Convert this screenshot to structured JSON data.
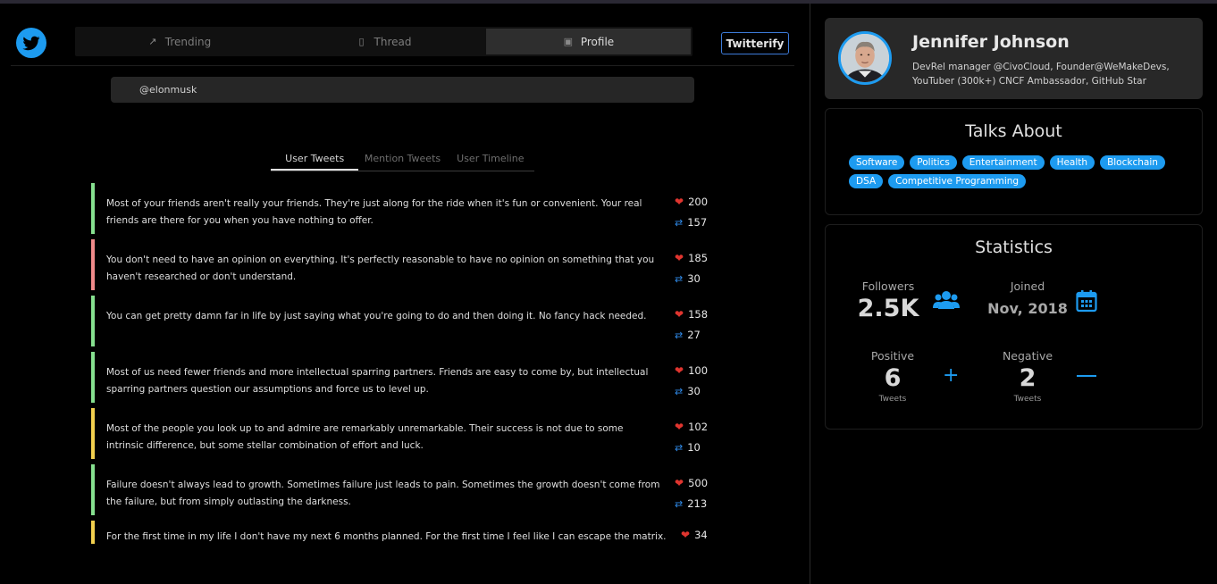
{
  "nav": {
    "tabs": [
      {
        "label": "Trending",
        "icon": "trending-icon"
      },
      {
        "label": "Thread",
        "icon": "document-icon"
      },
      {
        "label": "Profile",
        "icon": "profile-icon"
      }
    ],
    "active": "Profile",
    "cta_label": "Twitterify"
  },
  "search": {
    "value": "@elonmusk"
  },
  "subtabs": [
    "User Tweets",
    "Mention Tweets",
    "User Timeline"
  ],
  "tweets": [
    {
      "text": "Most of your friends aren't really your friends. They're just along for the ride when it's fun or convenient. Your real friends are there for you when you have nothing to offer.",
      "likes": "200",
      "retweets": "157",
      "sentiment_color": "#86e08f"
    },
    {
      "text": "You don't need to have an opinion on everything. It's perfectly reasonable to have no opinion on something that you haven't researched or don't understand.",
      "likes": "185",
      "retweets": "30",
      "sentiment_color": "#f08a8a"
    },
    {
      "text": "You can get pretty damn far in life by just saying what you're going to do and then doing it. No fancy hack needed.",
      "likes": "158",
      "retweets": "27",
      "sentiment_color": "#86e08f"
    },
    {
      "text": "Most of us need fewer friends and more intellectual sparring partners. Friends are easy to come by, but intellectual sparring partners question our assumptions and force us to level up.",
      "likes": "100",
      "retweets": "30",
      "sentiment_color": "#86e08f"
    },
    {
      "text": "Most of the people you look up to and admire are remarkably unremarkable. Their success is not due to some intrinsic difference, but some stellar combination of effort and luck.",
      "likes": "102",
      "retweets": "10",
      "sentiment_color": "#f2d04e"
    },
    {
      "text": "Failure doesn't always lead to growth. Sometimes failure just leads to pain. Sometimes the growth doesn't come from the failure, but from simply outlasting the darkness.",
      "likes": "500",
      "retweets": "213",
      "sentiment_color": "#86e08f"
    },
    {
      "text": "For the first time in my life I don't have my next 6 months planned. For the first time I feel like I can escape the matrix. For",
      "likes": "34",
      "sentiment_color": "#f2d04e"
    }
  ],
  "profile": {
    "name": "Jennifer Johnson",
    "bio": "DevRel manager @CivoCloud, Founder@WeMakeDevs, YouTuber (300k+) CNCF Ambassador, GitHub Star"
  },
  "talks": {
    "title": "Talks About",
    "topics": [
      "Software",
      "Politics",
      "Entertainment",
      "Health",
      "Blockchain",
      "DSA",
      "Competitive Programming"
    ]
  },
  "stats": {
    "title": "Statistics",
    "followers_label": "Followers",
    "followers_value": "2.5K",
    "joined_label": "Joined",
    "joined_value": "Nov, 2018",
    "positive_label": "Positive",
    "positive_value": "6",
    "positive_sub": "Tweets",
    "negative_label": "Negative",
    "negative_value": "2",
    "negative_sub": "Tweets"
  },
  "colors": {
    "accent": "#1d9bf0",
    "positive": "#86e08f",
    "negative": "#f08a8a",
    "neutral": "#f2d04e",
    "like": "#e0352f"
  }
}
